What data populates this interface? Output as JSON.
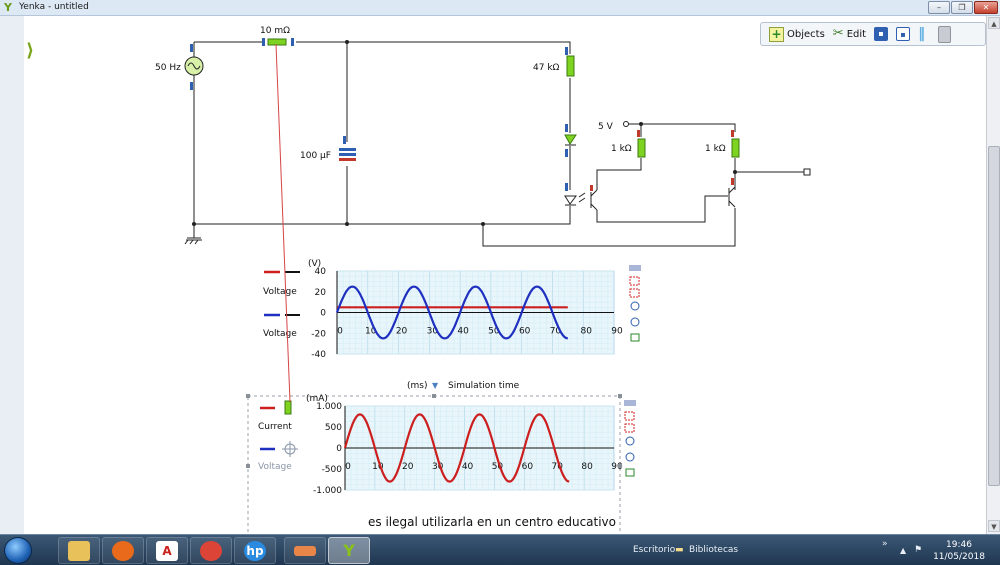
{
  "window": {
    "title": "Yenka - untitled",
    "minimize": "–",
    "maximize": "❐",
    "close": "✕"
  },
  "toolbar": {
    "objects_label": "Objects",
    "edit_label": "Edit"
  },
  "circuit": {
    "source_label": "50 Hz",
    "resistor_small_label": "10 mΩ",
    "capacitor_label": "100 μF",
    "resistor_large_label": "47 kΩ",
    "supply_label": "5 V",
    "resistor_1_label": "1 kΩ",
    "resistor_2_label": "1 kΩ"
  },
  "graph_voltage": {
    "unit_label": "(V)",
    "legend": [
      "Voltage",
      "Voltage"
    ],
    "y_ticks": [
      "40",
      "20",
      "0",
      "-20",
      "-40"
    ],
    "x_ticks": [
      "0",
      "10",
      "20",
      "30",
      "40",
      "50",
      "60",
      "70",
      "80",
      "90"
    ],
    "x_unit": "(ms)",
    "x_label": "Simulation time"
  },
  "graph_current": {
    "unit_label": "(mA)",
    "legend": [
      "Current",
      "Voltage"
    ],
    "y_ticks": [
      "1.000",
      "500",
      "0",
      "-500",
      "-1.000"
    ],
    "x_ticks": [
      "0",
      "10",
      "20",
      "30",
      "40",
      "50",
      "60",
      "70",
      "80",
      "90"
    ],
    "x_unit": "(ms)",
    "x_label": "Simulation time"
  },
  "watermark": "es ilegal utilizarla en un centro educativo",
  "taskbar": {
    "escritorio": "Escritorio",
    "bibliotecas": "Bibliotecas",
    "chevron": "»",
    "time": "19:46",
    "date": "11/05/2018"
  },
  "chart_data": [
    {
      "type": "line",
      "title": "",
      "ylabel": "(V)",
      "xlabel": "Simulation time",
      "xunit": "(ms)",
      "xlim": [
        0,
        90
      ],
      "ylim": [
        -40,
        40
      ],
      "grid": true,
      "legend_position": "left",
      "series": [
        {
          "name": "Voltage",
          "color": "#cc1f1f",
          "kind": "constant",
          "value": 5,
          "x_end": 75
        },
        {
          "name": "Voltage",
          "color": "#1f2fbf",
          "kind": "sine",
          "amplitude": 25,
          "offset": 0,
          "frequency_hz": 50,
          "x_end": 75
        }
      ]
    },
    {
      "type": "line",
      "title": "",
      "ylabel": "(mA)",
      "xlabel": "Simulation time",
      "xunit": "(ms)",
      "xlim": [
        0,
        90
      ],
      "ylim": [
        -1000,
        1000
      ],
      "grid": true,
      "legend_position": "left",
      "series": [
        {
          "name": "Current",
          "color": "#cc1f1f",
          "kind": "sine",
          "amplitude": 800,
          "offset": 0,
          "frequency_hz": 50,
          "x_end": 75
        }
      ]
    }
  ]
}
